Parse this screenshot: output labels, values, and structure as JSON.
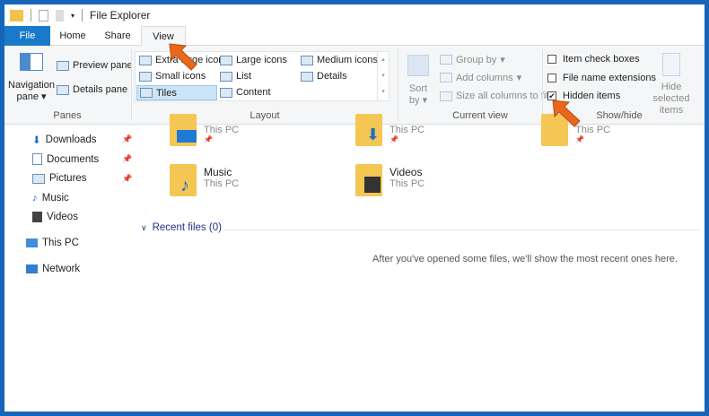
{
  "window": {
    "title": "File Explorer"
  },
  "tabs": [
    {
      "label": "File"
    },
    {
      "label": "Home"
    },
    {
      "label": "Share"
    },
    {
      "label": "View"
    }
  ],
  "ribbon": {
    "panes": {
      "navigation_pane": "Navigation",
      "navigation_pane2": "pane",
      "preview_pane": "Preview pane",
      "details_pane": "Details pane",
      "label": "Panes"
    },
    "layout": {
      "items": [
        "Extra large icons",
        "Large icons",
        "Medium icons",
        "Small icons",
        "List",
        "Details",
        "Tiles",
        "Content"
      ],
      "selected": "Tiles",
      "label": "Layout"
    },
    "current_view": {
      "sort_by": "Sort",
      "sort_by2": "by",
      "group_by": "Group by",
      "add_columns": "Add columns",
      "size_columns": "Size all columns to fit",
      "label": "Current view"
    },
    "show_hide": {
      "item_check_boxes": "Item check boxes",
      "item_check_boxes_checked": false,
      "file_name_extensions": "File name extensions",
      "file_name_extensions_checked": false,
      "hidden_items": "Hidden items",
      "hidden_items_checked": true,
      "hide_selected": "Hide selected",
      "hide_selected2": "items",
      "label": "Show/hide"
    }
  },
  "nav": {
    "quick": [
      "Downloads",
      "Documents",
      "Pictures",
      "Music",
      "Videos"
    ],
    "this_pc": "This PC",
    "network": "Network"
  },
  "tiles": [
    {
      "name": "",
      "sub": "This PC"
    },
    {
      "name": "",
      "sub": "This PC"
    },
    {
      "name": "",
      "sub": "This PC"
    },
    {
      "name": "Music",
      "sub": "This PC"
    },
    {
      "name": "Videos",
      "sub": "This PC"
    }
  ],
  "recent": {
    "header": "Recent files (0)",
    "empty": "After you've opened some files, we'll show the most recent ones here."
  },
  "colors": {
    "accent": "#1979ca",
    "frame": "#1565b8",
    "arrow": "#e8671c"
  }
}
